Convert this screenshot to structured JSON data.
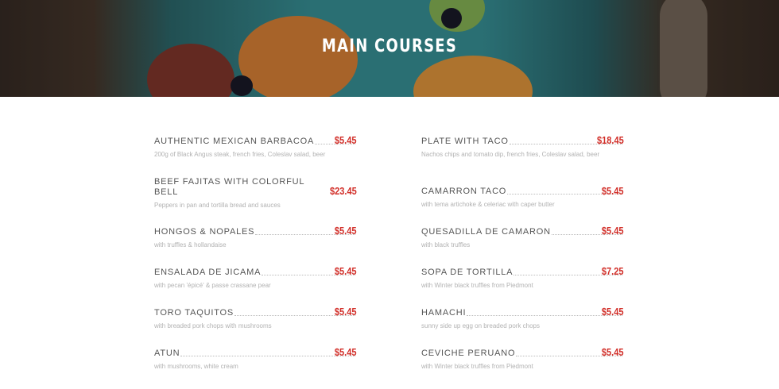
{
  "hero": {
    "title": "MAIN COURSES"
  },
  "colors": {
    "price": "#d2302a",
    "name": "#555555",
    "desc": "#b2b2b2"
  },
  "left": [
    {
      "name": "AUTHENTIC MEXICAN BARBACOA",
      "price": "$5.45",
      "desc": "200g of Black Angus steak, french fries, Coleslav salad, beer"
    },
    {
      "name": "BEEF FAJITAS WITH COLORFUL BELL",
      "price": "$23.45",
      "desc": "Peppers in pan and tortilla bread and sauces"
    },
    {
      "name": "HONGOS & NOPALES",
      "price": "$5.45",
      "desc": "with truffles & hollandaise"
    },
    {
      "name": "ENSALADA DE JICAMA",
      "price": "$5.45",
      "desc": "with pecan 'épicé' & passe crassane pear"
    },
    {
      "name": "TORO TAQUITOS",
      "price": "$5.45",
      "desc": "with breaded pork chops with mushrooms"
    },
    {
      "name": "ATUN",
      "price": "$5.45",
      "desc": "with mushrooms, white cream"
    }
  ],
  "right": [
    {
      "name": "PLATE WITH TACO",
      "price": "$18.45",
      "desc": "Nachos chips and tomato dip, french fries, Coleslav salad, beer"
    },
    {
      "name": "CAMARRON TACO",
      "price": "$5.45",
      "desc": "with tema artichoke & celeriac with caper butter"
    },
    {
      "name": "QUESADILLA DE CAMARON",
      "price": "$5.45",
      "desc": "with black truffles"
    },
    {
      "name": "SOPA DE TORTILLA",
      "price": "$7.25",
      "desc": "with Winter black truffles from Piedmont"
    },
    {
      "name": "HAMACHI",
      "price": "$5.45",
      "desc": "sunny side up egg on breaded pork chops"
    },
    {
      "name": "CEVICHE PERUANO",
      "price": "$5.45",
      "desc": "with Winter black truffles from Piedmont"
    }
  ]
}
